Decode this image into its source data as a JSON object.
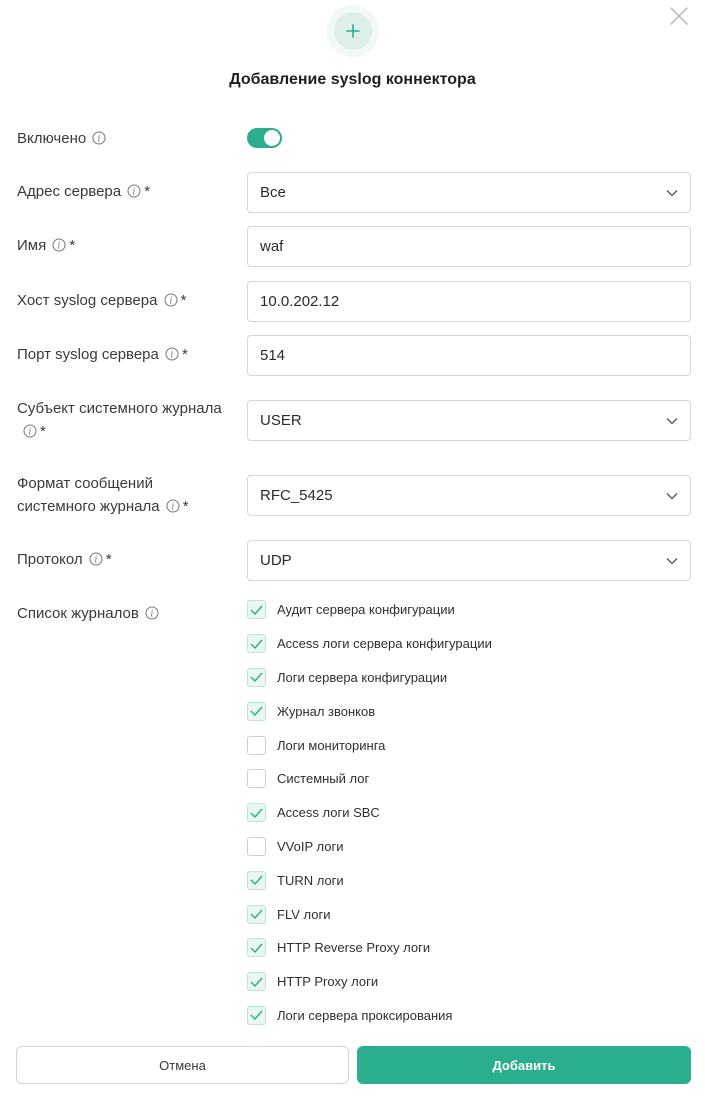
{
  "dialog": {
    "title": "Добавление syslog коннектора",
    "accent_color": "#2aae8e"
  },
  "form": {
    "enabled": {
      "label": "Включено",
      "value": true
    },
    "server_address": {
      "label": "Адрес сервера",
      "required": "*",
      "value": "Все"
    },
    "name": {
      "label": "Имя",
      "required": "*",
      "value": "waf"
    },
    "syslog_host": {
      "label": "Хост syslog сервера",
      "required": "*",
      "value": "10.0.202.12"
    },
    "syslog_port": {
      "label": "Порт syslog сервера",
      "required": "*",
      "value": "514"
    },
    "facility": {
      "label_line1": "Субъект системного журнала",
      "required": "*",
      "value": "USER"
    },
    "message_format": {
      "label_line1": "Формат сообщений",
      "label_line2": "системного журнала",
      "required": "*",
      "value": "RFC_5425"
    },
    "protocol": {
      "label": "Протокол",
      "required": "*",
      "value": "UDP"
    },
    "log_list": {
      "label": "Список журналов",
      "items": [
        {
          "label": "Аудит сервера конфигурации",
          "checked": true
        },
        {
          "label": "Access логи сервера конфигурации",
          "checked": true
        },
        {
          "label": "Логи сервера конфигурации",
          "checked": true
        },
        {
          "label": "Журнал звонков",
          "checked": true
        },
        {
          "label": "Логи мониторинга",
          "checked": false
        },
        {
          "label": "Системный лог",
          "checked": false
        },
        {
          "label": "Access логи SBC",
          "checked": true
        },
        {
          "label": "VVoIP логи",
          "checked": false
        },
        {
          "label": "TURN логи",
          "checked": true
        },
        {
          "label": "FLV логи",
          "checked": true
        },
        {
          "label": "HTTP Reverse Proxy логи",
          "checked": true
        },
        {
          "label": "HTTP Proxy логи",
          "checked": true
        },
        {
          "label": "Логи сервера проксирования",
          "checked": true
        }
      ]
    }
  },
  "footer": {
    "cancel_label": "Отмена",
    "add_label": "Добавить"
  }
}
